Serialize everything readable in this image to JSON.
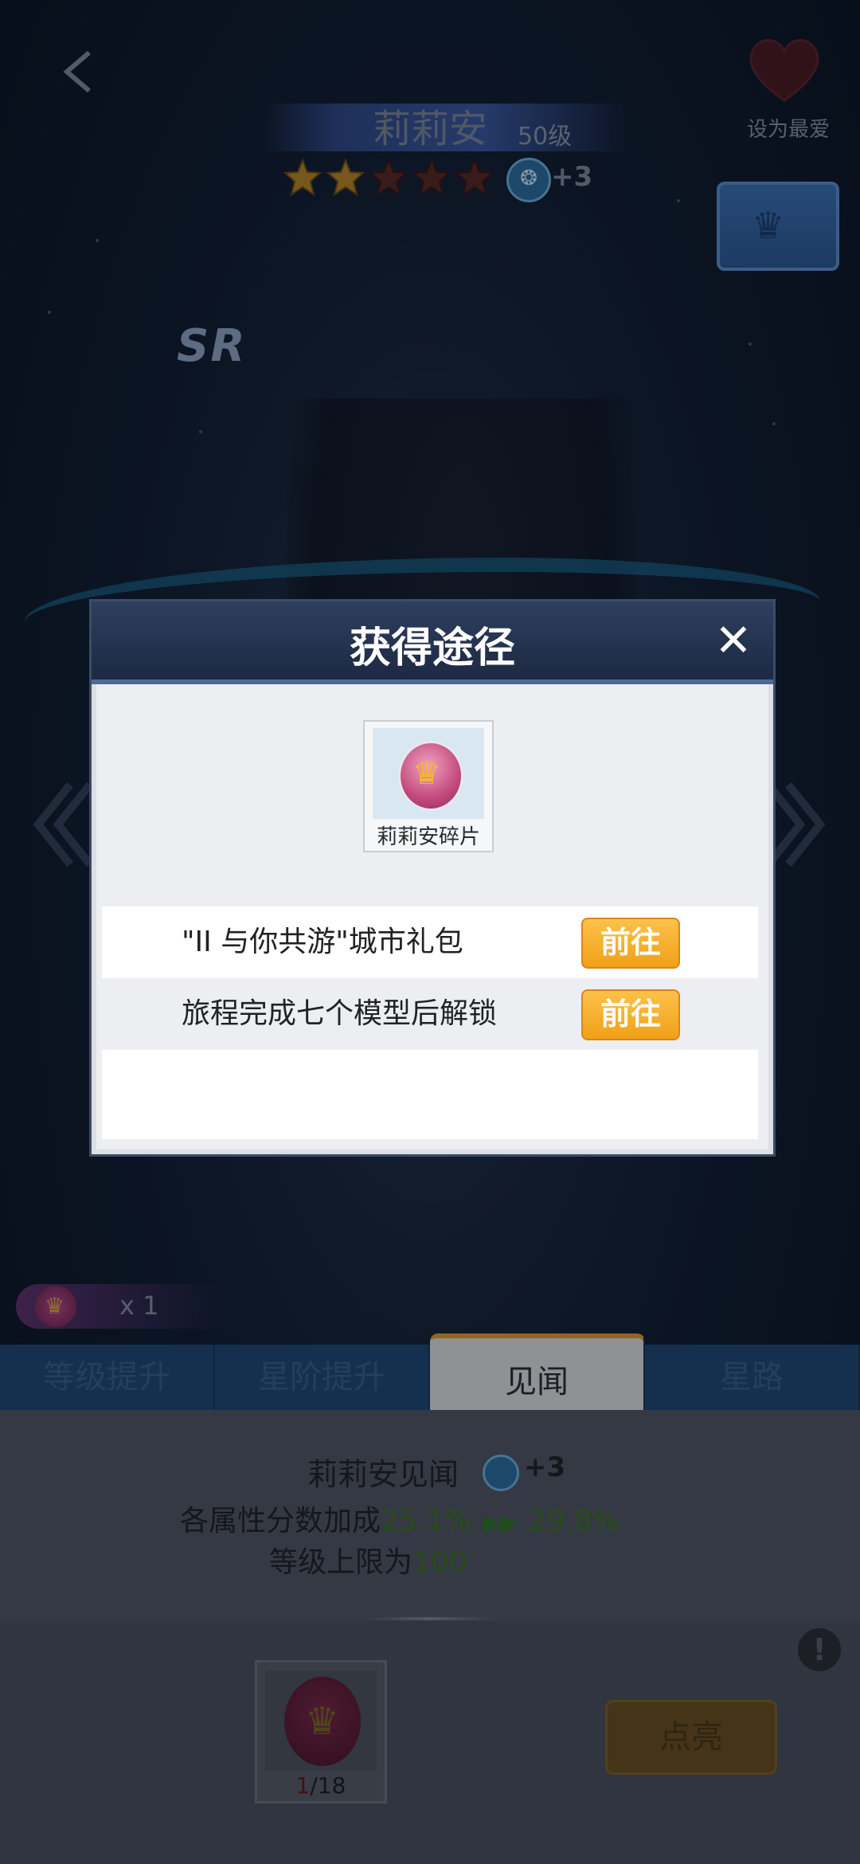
{
  "character": {
    "name": "莉莉安",
    "level": "50级",
    "stars_filled": 2,
    "stars_total": 5,
    "awaken_plus": "+3",
    "rarity": "SR"
  },
  "header": {
    "favorite_label": "设为最爱"
  },
  "fragment_counter": {
    "count": "x 1"
  },
  "tabs": [
    {
      "label": "等级提升"
    },
    {
      "label": "星阶提升"
    },
    {
      "label": "见闻"
    },
    {
      "label": "星路"
    }
  ],
  "active_tab": 2,
  "insight": {
    "title": "莉莉安见闻",
    "plus": "+3",
    "bonus_prefix": "各属性分数加成",
    "bonus_current": "25.1%",
    "bonus_next": "29.8%",
    "cap_prefix": "等级上限为",
    "cap_value": "100",
    "fragment_progress_current": "1",
    "fragment_progress_total": "/18",
    "light_button": "点亮"
  },
  "modal": {
    "title": "获得途径",
    "fragment_name": "莉莉安碎片",
    "routes": [
      {
        "label": "\"II 与你共游\"城市礼包",
        "button": "前往"
      },
      {
        "label": "旅程完成七个模型后解锁",
        "button": "前往"
      }
    ]
  },
  "colors": {
    "accent_orange": "#f1a018",
    "tab_active_border": "#e39b2e",
    "bonus_green": "#3d7524"
  }
}
